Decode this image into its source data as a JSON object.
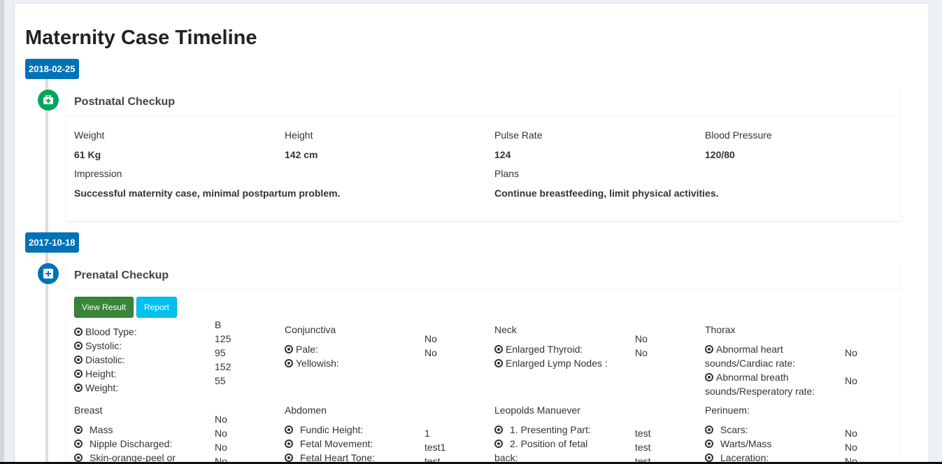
{
  "page": {
    "title": "Maternity Case Timeline"
  },
  "entries": [
    {
      "date": "2018-02-25",
      "title": "Postnatal Checkup",
      "icon": "medkit-icon",
      "icon_color": "#00a65a",
      "vitals": [
        {
          "label": "Weight",
          "value": "61 Kg"
        },
        {
          "label": "Height",
          "value": "142 cm"
        },
        {
          "label": "Pulse Rate",
          "value": "124"
        },
        {
          "label": "Blood Pressure",
          "value": "120/80"
        }
      ],
      "impression": {
        "label": "Impression",
        "value": "Successful maternity case, minimal postpartum problem."
      },
      "plans": {
        "label": "Plans",
        "value": "Continue breastfeeding, limit physical activities."
      }
    },
    {
      "date": "2017-10-18",
      "title": "Prenatal Checkup",
      "icon": "plus-square-icon",
      "icon_color": "#0073b7",
      "buttons": {
        "view_result": "View Result",
        "report": "Report"
      },
      "vitals": {
        "labels": [
          "Blood Type:",
          "Systolic:",
          "Diastolic:",
          "Height:",
          "Weight:"
        ],
        "values": [
          "B",
          "125",
          "95",
          "152",
          "55"
        ]
      },
      "conjunctiva": {
        "title": "Conjunctiva",
        "items": [
          {
            "label": "Pale:",
            "value": "No"
          },
          {
            "label": "Yellowish:",
            "value": "No"
          }
        ]
      },
      "neck": {
        "title": "Neck",
        "items": [
          {
            "label": "Enlarged Thyroid:",
            "value": "No"
          },
          {
            "label": "Enlarged Lymp Nodes :",
            "value": "No"
          }
        ]
      },
      "thorax": {
        "title": "Thorax",
        "items": [
          {
            "label_line1": "Abnormal heart",
            "label_line2": "sounds/Cardiac rate:",
            "value": "No"
          },
          {
            "label_line1": "Abnormal breath",
            "label_line2": "sounds/Resperatory rate:",
            "value": "No"
          }
        ]
      },
      "breast": {
        "title": "Breast",
        "items": [
          {
            "label": "Mass",
            "value": "No"
          },
          {
            "label": "Nipple Discharged:",
            "value": "No"
          },
          {
            "label": "Skin-orange-peel or",
            "value": "No"
          }
        ],
        "extra_value": "No"
      },
      "abdomen": {
        "title": "Abdomen",
        "items": [
          {
            "label": "Fundic Height:",
            "value": "1"
          },
          {
            "label": "Fetal Movement:",
            "value": "test1"
          },
          {
            "label": "Fetal Heart Tone:",
            "value": "test"
          }
        ]
      },
      "leopolds": {
        "title": "Leopolds Manuever",
        "items": [
          {
            "label": "1. Presenting Part:",
            "value": "test"
          },
          {
            "label": "2. Position of fetal",
            "value": "test"
          }
        ],
        "cont_label": "back:",
        "extra_value": "test"
      },
      "perineum": {
        "title": "Perinuem:",
        "items": [
          {
            "label": "Scars:",
            "value": "No"
          },
          {
            "label": "Warts/Mass",
            "value": "No"
          },
          {
            "label": "Laceration:",
            "value": "No"
          }
        ]
      }
    }
  ]
}
